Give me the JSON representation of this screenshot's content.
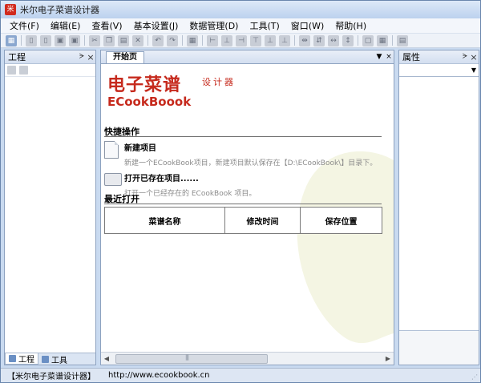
{
  "window": {
    "title": "米尔电子菜谱设计器",
    "app_icon": "米"
  },
  "menu": [
    {
      "label": "文件(F)"
    },
    {
      "label": "编辑(E)"
    },
    {
      "label": "查看(V)"
    },
    {
      "label": "基本设置(J)"
    },
    {
      "label": "数据管理(D)"
    },
    {
      "label": "工具(T)"
    },
    {
      "label": "窗口(W)"
    },
    {
      "label": "帮助(H)"
    }
  ],
  "toolbar": {
    "icons": [
      "app-icon",
      "new-icon",
      "open-icon",
      "save-icon",
      "saveall-icon",
      "cut-icon",
      "copy-icon",
      "paste-icon",
      "delete-icon",
      "undo-icon",
      "redo-icon",
      "table-icon",
      "align-left-icon",
      "align-center-icon",
      "align-right-icon",
      "align-top-icon",
      "align-middle-icon",
      "align-bottom-icon",
      "distribute-h-icon",
      "distribute-v-icon",
      "same-width-icon",
      "same-height-icon",
      "same-size-icon",
      "grid-icon",
      "bring-front-icon",
      "send-back-icon"
    ]
  },
  "left_panel": {
    "title": "工程",
    "pin": "ᗔ",
    "close": "×",
    "tabs": [
      {
        "label": "工程",
        "active": true
      },
      {
        "label": "工具",
        "active": false
      }
    ]
  },
  "center": {
    "tab_label": "开始页",
    "logo": {
      "cn": "电子菜谱",
      "sub": "设计器",
      "en": "ECookBoook"
    },
    "quick_ops_label": "快捷操作",
    "new_project": {
      "title": "新建项目",
      "desc": "新建一个ECookBook项目，新建项目默认保存在【D:\\ECookBook\\】目录下。"
    },
    "open_project": {
      "title": "打开已存在项目......",
      "desc": "打开一个已经存在的 ECookBook 项目。"
    },
    "recent_label": "最近打开",
    "recent_columns": [
      "菜谱名称",
      "修改时间",
      "保存位置"
    ]
  },
  "right_panel": {
    "title": "属性",
    "pin": "ᗔ",
    "close": "×"
  },
  "status": {
    "app": "【米尔电子菜谱设计器】",
    "url": "http://www.ecookbook.cn"
  }
}
